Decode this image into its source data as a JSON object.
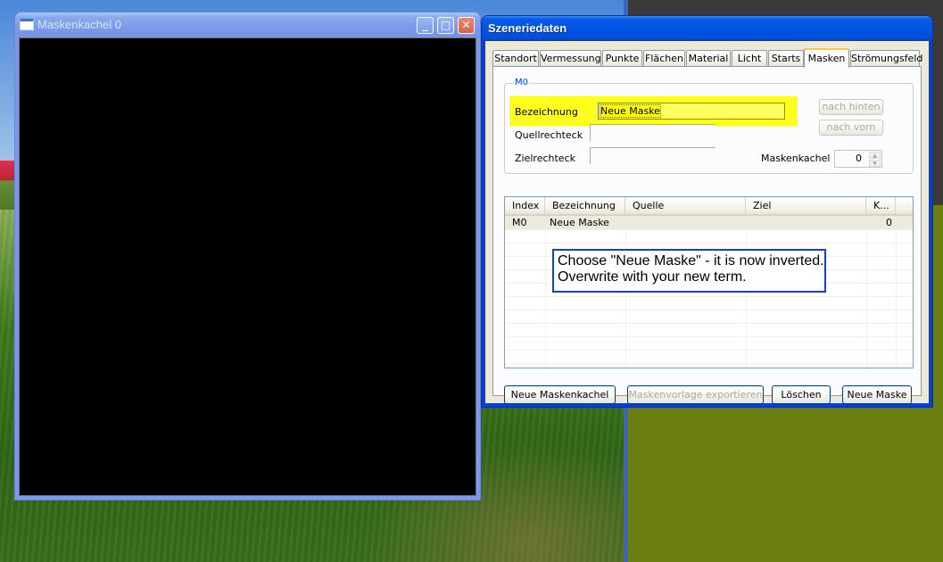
{
  "mask_window": {
    "title": "Maskenkachel 0",
    "controls": {
      "minimize": "_",
      "maximize": "□",
      "close": "✕"
    }
  },
  "dialog": {
    "title": "Szeneriedaten",
    "tabs": [
      "Standort",
      "Vermessung",
      "Punkte",
      "Flächen",
      "Material",
      "Licht",
      "Starts",
      "Masken",
      "Strömungsfeld"
    ],
    "active_tab": "Masken",
    "group": {
      "label": "M0",
      "bezeichnung_label": "Bezeichnung",
      "bezeichnung_value": "Neue Maske",
      "quellrechteck_label": "Quellrechteck",
      "quellrechteck_value": "",
      "zielrechteck_label": "Zielrechteck",
      "zielrechteck_value": "",
      "nach_hinten": "nach hinten",
      "nach_vorn": "nach vorn",
      "maskenkachel_label": "Maskenkachel",
      "maskenkachel_value": "0"
    },
    "list": {
      "columns": [
        "Index",
        "Bezeichnung",
        "Quelle",
        "Ziel",
        "K..."
      ],
      "rows": [
        {
          "index": "M0",
          "bezeichnung": "Neue Maske",
          "quelle": "",
          "ziel": "",
          "k": "0"
        }
      ]
    },
    "buttons": {
      "neue_maskenkachel": "Neue Maskenkachel",
      "maskenvorlage_exportieren": "Maskenvorlage exportieren",
      "loeschen": "Löschen",
      "neue_maske": "Neue Maske"
    }
  },
  "callout": {
    "line1": "Choose \"Neue Maske\" - it is now inverted.",
    "line2": "Overwrite with your new term."
  },
  "colors": {
    "highlight": "#ffff1e",
    "xp_title_blue": "#0054e3",
    "callout_border": "#1740c8",
    "dialog_face": "#ece9d8"
  }
}
